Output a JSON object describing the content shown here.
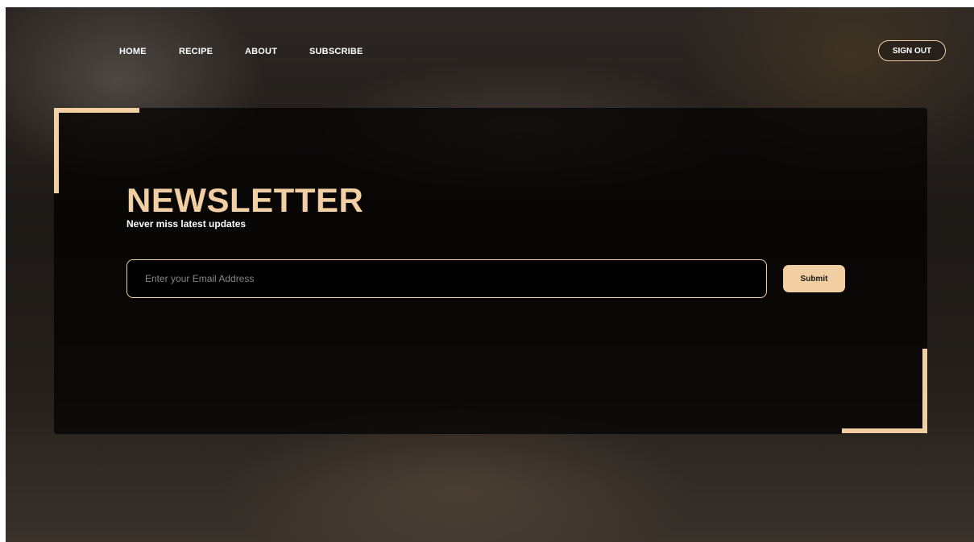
{
  "nav": {
    "items": [
      {
        "label": "HOME"
      },
      {
        "label": "RECIPE"
      },
      {
        "label": "ABOUT"
      },
      {
        "label": "SUBSCRIBE"
      }
    ],
    "sign_out_label": "SIGN OUT"
  },
  "newsletter": {
    "title": "NEWSLETTER",
    "subtitle": "Never miss latest updates",
    "email_placeholder": "Enter your Email Address",
    "email_value": "",
    "submit_label": "Submit"
  },
  "colors": {
    "accent": "#f2cfa3",
    "panel": "#000000",
    "text": "#ffffff"
  }
}
